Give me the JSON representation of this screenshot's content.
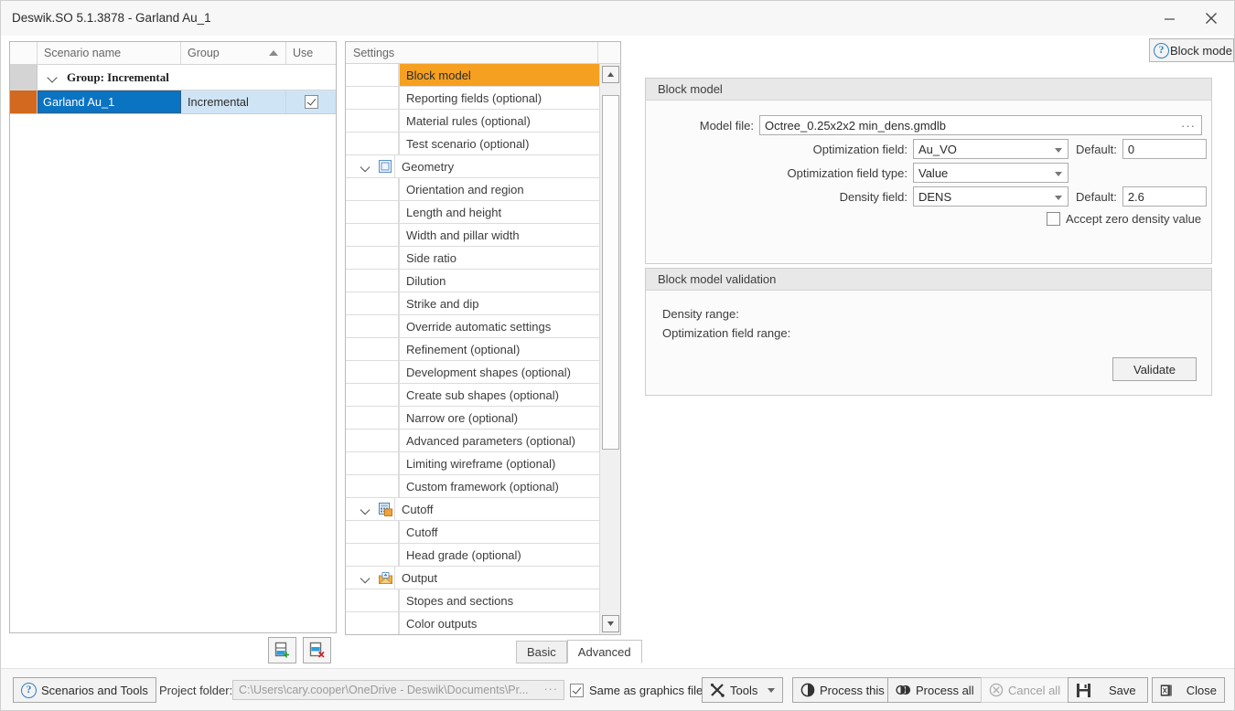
{
  "window": {
    "title": "Deswik.SO 5.1.3878 - Garland Au_1",
    "minimize_label": "minimize-icon",
    "close_label": "close-icon"
  },
  "block_mode_button": {
    "label": "Block mode",
    "help_icon": "?"
  },
  "scenario_grid": {
    "columns": [
      "",
      "Scenario name",
      "Group",
      "Use"
    ],
    "sort_column": "Group",
    "sort_direction": "ascending",
    "group_row": {
      "label": "Group: Incremental",
      "expanded": true
    },
    "rows": [
      {
        "name": "Garland Au_1",
        "group": "Incremental",
        "use": true,
        "selected": true
      }
    ]
  },
  "grid_buttons": {
    "add": "add-scenario",
    "delete": "delete-scenario"
  },
  "tree": {
    "header": "Settings",
    "nodes": [
      {
        "label": "Block model",
        "level": "leaf",
        "selected": true
      },
      {
        "label": "Reporting fields (optional)",
        "level": "leaf",
        "selected": false
      },
      {
        "label": "Material rules (optional)",
        "level": "leaf",
        "selected": false
      },
      {
        "label": "Test scenario (optional)",
        "level": "leaf",
        "selected": false
      },
      {
        "label": "Geometry",
        "level": "parent",
        "icon": "geometry-icon",
        "expanded": true
      },
      {
        "label": "Orientation and region",
        "level": "leaf",
        "selected": false
      },
      {
        "label": "Length and height",
        "level": "leaf",
        "selected": false
      },
      {
        "label": "Width and pillar width",
        "level": "leaf",
        "selected": false
      },
      {
        "label": "Side ratio",
        "level": "leaf",
        "selected": false
      },
      {
        "label": "Dilution",
        "level": "leaf",
        "selected": false
      },
      {
        "label": "Strike and dip",
        "level": "leaf",
        "selected": false
      },
      {
        "label": "Override automatic settings",
        "level": "leaf",
        "selected": false
      },
      {
        "label": "Refinement (optional)",
        "level": "leaf",
        "selected": false
      },
      {
        "label": "Development shapes (optional)",
        "level": "leaf",
        "selected": false
      },
      {
        "label": "Create sub shapes (optional)",
        "level": "leaf",
        "selected": false
      },
      {
        "label": "Narrow ore (optional)",
        "level": "leaf",
        "selected": false
      },
      {
        "label": "Advanced parameters (optional)",
        "level": "leaf",
        "selected": false
      },
      {
        "label": "Limiting wireframe (optional)",
        "level": "leaf",
        "selected": false
      },
      {
        "label": "Custom framework (optional)",
        "level": "leaf",
        "selected": false
      },
      {
        "label": "Cutoff",
        "level": "parent",
        "icon": "calculator-icon",
        "expanded": true
      },
      {
        "label": "Cutoff",
        "level": "leaf",
        "selected": false
      },
      {
        "label": "Head grade (optional)",
        "level": "leaf",
        "selected": false
      },
      {
        "label": "Output",
        "level": "parent",
        "icon": "envelope-icon",
        "expanded": true
      },
      {
        "label": "Stopes and sections",
        "level": "leaf",
        "selected": false
      },
      {
        "label": "Color outputs",
        "level": "leaf",
        "selected": false
      }
    ]
  },
  "tabs": [
    {
      "label": "Basic",
      "active": false
    },
    {
      "label": "Advanced",
      "active": true
    }
  ],
  "block_model_panel": {
    "title": "Block model",
    "model_file_label": "Model file:",
    "model_file_value": "Octree_0.25x2x2 min_dens.gmdlb",
    "optimization_field_label": "Optimization field:",
    "optimization_field_value": "Au_VO",
    "optimization_field_default_label": "Default:",
    "optimization_field_default_value": "0",
    "optimization_field_type_label": "Optimization field type:",
    "optimization_field_type_value": "Value",
    "density_field_label": "Density field:",
    "density_field_value": "DENS",
    "density_default_label": "Default:",
    "density_default_value": "2.6",
    "accept_zero_label": "Accept zero density value",
    "accept_zero_checked": false
  },
  "validation_panel": {
    "title": "Block model validation",
    "density_range_label": "Density range:",
    "optimization_field_range_label": "Optimization field range:",
    "validate_button": "Validate"
  },
  "bottom_bar": {
    "scenarios_and_tools": "Scenarios and Tools",
    "project_folder_label": "Project folder:",
    "project_folder_value": "C:\\Users\\cary.cooper\\OneDrive - Deswik\\Documents\\Pr...",
    "same_as_graphics_label": "Same as graphics file",
    "same_as_graphics_checked": true,
    "tools": "Tools",
    "process_this": "Process this",
    "process_all": "Process all",
    "cancel_all": "Cancel all",
    "save": "Save",
    "close": "Close"
  },
  "colors": {
    "selected_tree_item": "#f5a020",
    "selected_row": "#0a73c2",
    "row_indicator": "#d2691e",
    "panel_header": "#e8e8e8"
  }
}
